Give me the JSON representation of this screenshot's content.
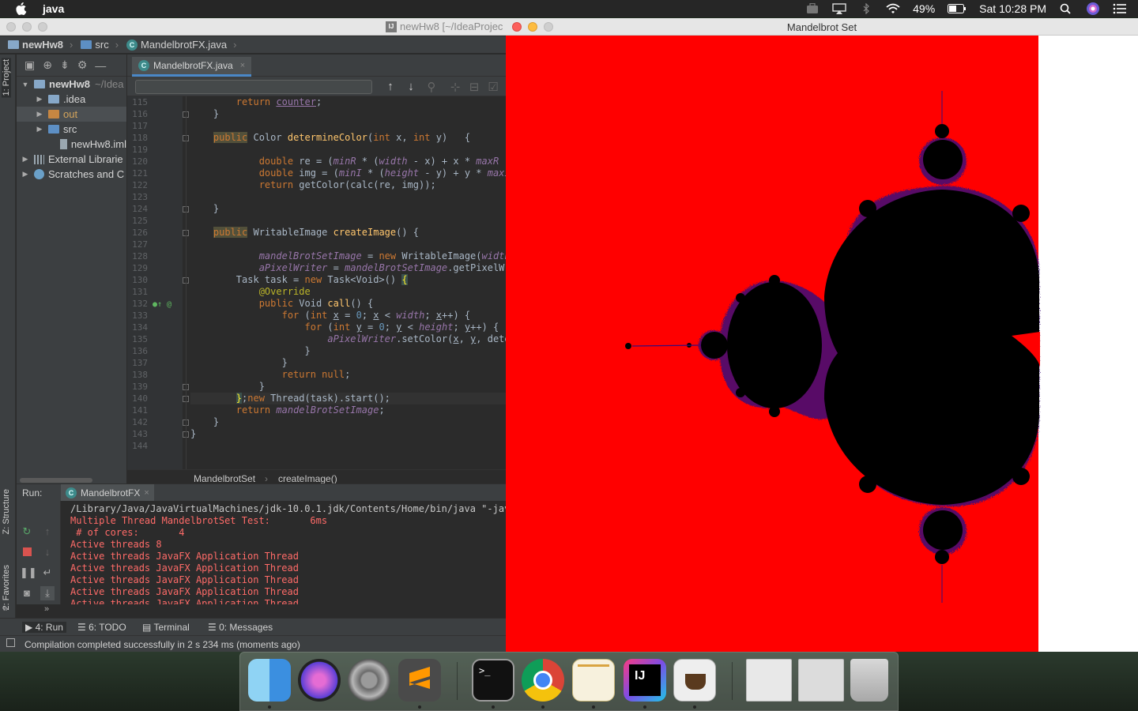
{
  "menubar": {
    "app_name": "java",
    "battery": "49%",
    "clock": "Sat 10:28 PM"
  },
  "ide": {
    "window_title": "newHw8 [~/IdeaProjec",
    "breadcrumb": [
      "newHw8",
      "src",
      "MandelbrotFX.java"
    ],
    "left_tabs": {
      "project": "1: Project",
      "structure": "Z: Structure",
      "favorites": "2: Favorites"
    },
    "project_tree": [
      {
        "label": "newHw8",
        "extra": "~/Idea",
        "indent": 0,
        "arrow": "▼",
        "kind": "module"
      },
      {
        "label": ".idea",
        "indent": 1,
        "arrow": "▶",
        "kind": "folder"
      },
      {
        "label": "out",
        "indent": 1,
        "arrow": "▶",
        "kind": "folder-orange"
      },
      {
        "label": "src",
        "indent": 1,
        "arrow": "▶",
        "kind": "folder-blue"
      },
      {
        "label": "newHw8.iml",
        "indent": 2,
        "arrow": "",
        "kind": "file"
      },
      {
        "label": "External Librarie",
        "indent": 0,
        "arrow": "▶",
        "kind": "lib"
      },
      {
        "label": "Scratches and C",
        "indent": 0,
        "arrow": "▶",
        "kind": "scratch"
      }
    ],
    "editor_tab": "MandelbrotFX.java",
    "search_placeholder": "",
    "code_lines": [
      {
        "n": "115",
        "html": "        <span class='kw'>return</span> <span class='fldn und'>counter</span>;"
      },
      {
        "n": "116",
        "html": "    }"
      },
      {
        "n": "117",
        "html": ""
      },
      {
        "n": "118",
        "html": "    <span class='kwhl'>public</span> Color <span class='fn'>determineColor</span>(<span class='kw'>int</span> x, <span class='kw'>int</span> y)   {"
      },
      {
        "n": "119",
        "html": ""
      },
      {
        "n": "120",
        "html": "            <span class='kw'>double</span> re = (<span class='fld'>minR</span> * (<span class='fld'>width</span> - x) + x * <span class='fld'>maxR</span>"
      },
      {
        "n": "121",
        "html": "            <span class='kw'>double</span> img = (<span class='fld'>minI</span> * (<span class='fld'>height</span> - y) + y * <span class='fld'>maxI</span>"
      },
      {
        "n": "122",
        "html": "            <span class='kw'>return</span> getColor(calc(re, img));"
      },
      {
        "n": "123",
        "html": ""
      },
      {
        "n": "124",
        "html": "    }"
      },
      {
        "n": "125",
        "html": ""
      },
      {
        "n": "126",
        "html": "    <span class='kwhl'>public</span> WritableImage <span class='fn'>createImage</span>() {"
      },
      {
        "n": "127",
        "html": ""
      },
      {
        "n": "128",
        "html": "            <span class='fld'>mandelBrotSetImage</span> = <span class='kw'>new</span> WritableImage(<span class='fld'>width</span>"
      },
      {
        "n": "129",
        "html": "            <span class='fld'>aPixelWriter</span> = <span class='fld'>mandelBrotSetImage</span>.getPixelW"
      },
      {
        "n": "130",
        "html": "        Task task = <span class='kw'>new</span> Task&lt;Void&gt;() <span class='br'>{</span>"
      },
      {
        "n": "131",
        "html": "            <span class='ann'>@Override</span>"
      },
      {
        "n": "132",
        "html": "            <span class='kw'>public</span> Void <span class='fn'>call</span>() {"
      },
      {
        "n": "133",
        "html": "                <span class='kw'>for</span> (<span class='kw'>int</span> <span class='und'>x</span> = <span class='num'>0</span>; <span class='und'>x</span> &lt; <span class='fld'>width</span>; <span class='und'>x</span>++) {"
      },
      {
        "n": "134",
        "html": "                    <span class='kw'>for</span> (<span class='kw'>int</span> <span class='und'>y</span> = <span class='num'>0</span>; <span class='und'>y</span> &lt; <span class='fld'>height</span>; <span class='und'>y</span>++) {"
      },
      {
        "n": "135",
        "html": "                        <span class='fld'>aPixelWriter</span>.setColor(<span class='und'>x</span>, <span class='und'>y</span>, determ"
      },
      {
        "n": "136",
        "html": "                    }"
      },
      {
        "n": "137",
        "html": "                }"
      },
      {
        "n": "138",
        "html": "                <span class='kw'>return null</span>;"
      },
      {
        "n": "139",
        "html": "            }"
      },
      {
        "n": "140",
        "html": "        <span class='br'>}</span>;<span class='kw'>new</span> Thread(task).start();"
      },
      {
        "n": "141",
        "html": "        <span class='kw'>return</span> <span class='fld'>mandelBrotSetImage</span>;"
      },
      {
        "n": "142",
        "html": "    }"
      },
      {
        "n": "143",
        "html": "}"
      },
      {
        "n": "144",
        "html": ""
      }
    ],
    "bottom_breadcrumb": [
      "MandelbrotSet",
      "createImage()"
    ],
    "run": {
      "label": "Run:",
      "tab": "MandelbrotFX",
      "console": [
        "/Library/Java/JavaVirtualMachines/jdk-10.0.1.jdk/Contents/Home/bin/java \"-javaa",
        "Multiple Thread MandelbrotSet Test:       6ms",
        " # of cores:       4",
        "Active threads 8",
        "Active threads JavaFX Application Thread",
        "Active threads JavaFX Application Thread",
        "Active threads JavaFX Application Thread",
        "Active threads JavaFX Application Thread",
        "Active threads JavaFX Application Thread"
      ]
    },
    "bottom_tabs": {
      "run": "4: Run",
      "todo": "6: TODO",
      "terminal": "Terminal",
      "messages": "0: Messages"
    },
    "status": "Compilation completed successfully in 2 s 234 ms (moments ago)"
  },
  "mandel": {
    "window_title": "Mandelbrot Set"
  },
  "colors": {
    "ide_bg": "#2b2b2b",
    "panel_bg": "#3c3f41",
    "mandel_red": "#ff0000",
    "mandel_set": "#000000",
    "mandel_edge": "#3a0b7a"
  },
  "dock": {
    "apps": [
      "finder-icon",
      "siri-icon",
      "system-preferences-icon",
      "sublime-text-icon",
      "terminal-icon",
      "chrome-icon",
      "textedit-icon",
      "intellij-icon",
      "java-icon",
      "documents-stack-icon",
      "downloads-stack-icon",
      "trash-icon"
    ]
  }
}
